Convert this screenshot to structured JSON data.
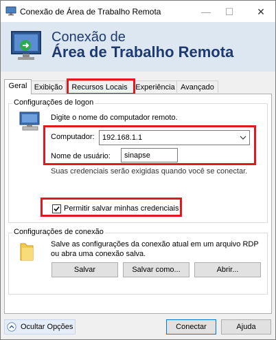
{
  "window": {
    "title": "Conexão de Área de Trabalho Remota",
    "controls": {
      "minimize": "—",
      "maximize": "☐",
      "close": "✕"
    }
  },
  "banner": {
    "line1": "Conexão de",
    "line2": "Área de Trabalho Remota"
  },
  "tabs": [
    {
      "label": "Geral"
    },
    {
      "label": "Exibição"
    },
    {
      "label": "Recursos Locais"
    },
    {
      "label": "Experiência"
    },
    {
      "label": "Avançado"
    }
  ],
  "logon": {
    "legend": "Configurações de logon",
    "hint": "Digite o nome do computador remoto.",
    "computer_label": "Computador:",
    "computer_value": "192.168.1.1",
    "user_label": "Nome de usuário:",
    "user_value": "sinapse",
    "credentials_note": "Suas credenciais serão exigidas quando você se conectar.",
    "save_credentials_label": "Permitir salvar minhas credenciais",
    "save_credentials_checked": true
  },
  "connection": {
    "legend": "Configurações de conexão",
    "desc_line1": "Salve as configurações da conexão atual em um arquivo RDP",
    "desc_line2": "ou abra uma conexão salva.",
    "save_label": "Salvar",
    "save_as_label": "Salvar como...",
    "open_label": "Abrir..."
  },
  "footer": {
    "hide_options_label": "Ocultar Opções",
    "connect_label": "Conectar",
    "help_label": "Ajuda"
  },
  "colors": {
    "highlight": "#e0181f",
    "banner_text": "#1e3a6e",
    "banner_bg": "#dde7f1"
  }
}
